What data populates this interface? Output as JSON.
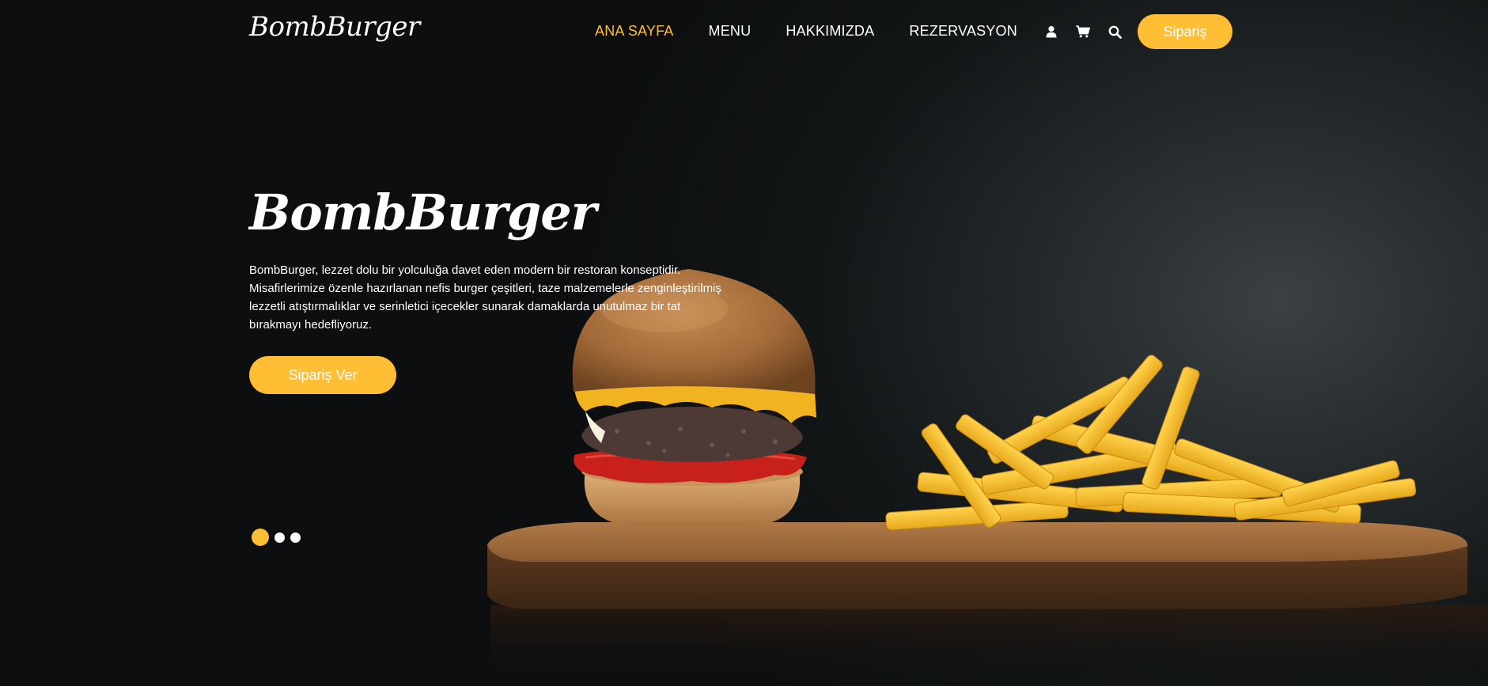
{
  "brand": {
    "logo_text": "BombBurger",
    "accent_color": "#ffbe33"
  },
  "nav": {
    "links": [
      {
        "label": "ANA SAYFA",
        "active": true
      },
      {
        "label": "MENU",
        "active": false
      },
      {
        "label": "HAKKIMIZDA",
        "active": false
      },
      {
        "label": "REZERVASYON",
        "active": false
      }
    ],
    "icons": [
      "user-icon",
      "cart-icon",
      "search-icon"
    ],
    "order_button_label": "Sipariş"
  },
  "hero": {
    "title": "BombBurger",
    "description": "BombBurger, lezzet dolu bir yolculuğa davet eden modern bir restoran konseptidir. Misafirlerimize özenle hazırlanan nefis burger çeşitleri, taze malzemelerle zenginleştirilmiş lezzetli atıştırmalıklar ve serinletici içecekler sunarak damaklarda unutulmaz bir tat bırakmayı hedefliyoruz.",
    "cta_label": "Sipariş Ver",
    "carousel": {
      "slides": 3,
      "active_index": 0
    }
  }
}
